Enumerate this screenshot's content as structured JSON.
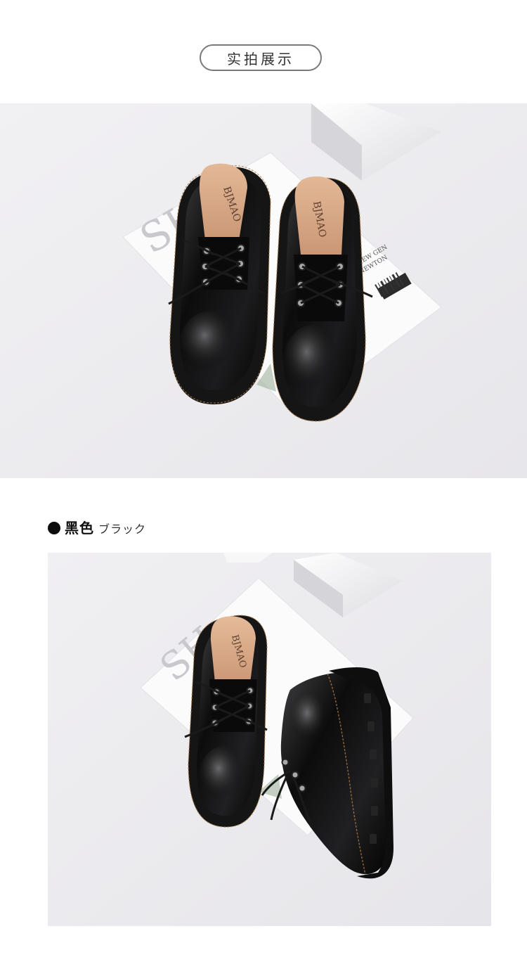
{
  "header": {
    "section_title": "实拍展示"
  },
  "photos": {
    "top": {
      "insole_brand_left": "BJMAO",
      "insole_brand_right": "BJMAO",
      "magazine_big_letters": "SH",
      "tag_text_line1": "NEW GEN",
      "tag_text_line2": "NEWTON"
    },
    "bottom": {
      "insole_brand": "BJMAO",
      "magazine_big_letters": "SH"
    }
  },
  "color_option": {
    "name": "黑色",
    "name_jp": "ブラック",
    "swatch_color": "#0d0d0d"
  }
}
